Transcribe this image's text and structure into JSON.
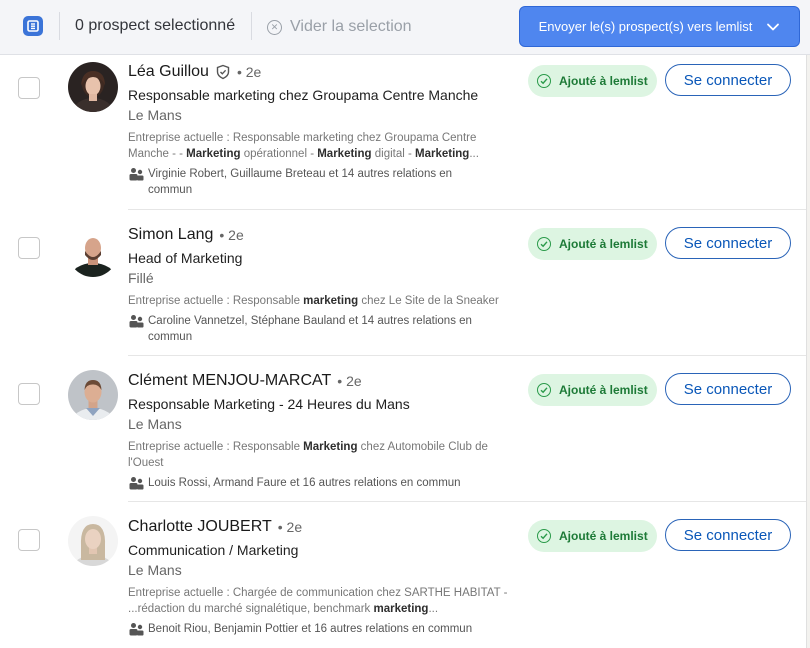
{
  "toolbar": {
    "selected_count_text": "0 prospect selectionné",
    "clear_selection_label": "Vider la selection",
    "send_button_label": "Envoyer le(s) prospect(s) vers lemlist",
    "accent_color": "#4f86ef",
    "logo_icon": "lemlist-logo-icon"
  },
  "prospects": [
    {
      "name": "Léa Guillou",
      "verified": true,
      "degree": "• 2e",
      "headline": "Responsable marketing chez Groupama Centre Manche",
      "location": "Le Mans",
      "company_parts": [
        {
          "t": "Entreprise actuelle  : Responsable marketing chez Groupama Centre Manche - - ",
          "b": false
        },
        {
          "t": "Marketing",
          "b": true
        },
        {
          "t": " opérationnel - ",
          "b": false
        },
        {
          "t": "Marketing",
          "b": true
        },
        {
          "t": " digital - ",
          "b": false
        },
        {
          "t": "Marketing",
          "b": true
        },
        {
          "t": "...",
          "b": false
        }
      ],
      "relations": "Virginie Robert, Guillaume Breteau et 14 autres relations en commun",
      "badge": "Ajouté à lemlist",
      "connect": "Se connecter"
    },
    {
      "name": "Simon Lang",
      "verified": false,
      "degree": "• 2e",
      "headline": "Head of Marketing",
      "location": "Fillé",
      "company_parts": [
        {
          "t": "Entreprise actuelle  : Responsable ",
          "b": false
        },
        {
          "t": "marketing",
          "b": true
        },
        {
          "t": " chez Le Site de la Sneaker",
          "b": false
        }
      ],
      "relations": "Caroline Vannetzel, Stéphane Bauland et 14 autres relations en commun",
      "badge": "Ajouté à lemlist",
      "connect": "Se connecter"
    },
    {
      "name": "Clément MENJOU-MARCAT",
      "verified": false,
      "degree": "• 2e",
      "headline": "Responsable Marketing - 24 Heures du Mans",
      "location": "Le Mans",
      "company_parts": [
        {
          "t": "Entreprise actuelle  : Responsable ",
          "b": false
        },
        {
          "t": "Marketing",
          "b": true
        },
        {
          "t": " chez Automobile Club de l'Ouest",
          "b": false
        }
      ],
      "relations": "Louis Rossi, Armand Faure et 16 autres relations en commun",
      "badge": "Ajouté à lemlist",
      "connect": "Se connecter"
    },
    {
      "name": "Charlotte JOUBERT",
      "verified": false,
      "degree": "• 2e",
      "headline": "Communication / Marketing",
      "location": "Le Mans",
      "company_parts": [
        {
          "t": "Entreprise actuelle  : Chargée de communication chez SARTHE HABITAT - ...rédaction du marché signalétique, benchmark ",
          "b": false
        },
        {
          "t": "marketing",
          "b": true
        },
        {
          "t": "...",
          "b": false
        }
      ],
      "relations": "Benoit Riou, Benjamin Pottier et 16 autres relations en commun",
      "badge": "Ajouté à lemlist",
      "connect": "Se connecter"
    }
  ]
}
